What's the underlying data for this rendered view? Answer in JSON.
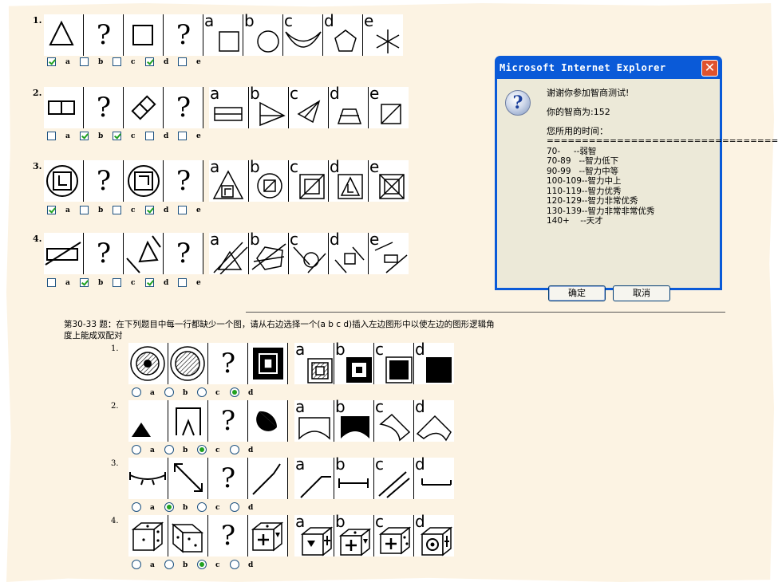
{
  "sectionA": {
    "problems": [
      {
        "num": "1.",
        "checked": [
          true,
          false,
          false,
          true,
          false
        ]
      },
      {
        "num": "2.",
        "checked": [
          false,
          true,
          true,
          false,
          false
        ]
      },
      {
        "num": "3.",
        "checked": [
          true,
          false,
          false,
          true,
          false
        ]
      },
      {
        "num": "4.",
        "checked": [
          false,
          true,
          false,
          true,
          false
        ]
      }
    ],
    "option_letters": [
      "a",
      "b",
      "c",
      "d",
      "e"
    ],
    "question_mark": "?"
  },
  "instruction": "第30-33 题：在下列题目中每一行都缺少一个图，请从右边选择一个(a b c d)插入左边图形中以使左边的图形逻辑角度上能成双配对",
  "sectionB": {
    "problems": [
      {
        "num": "1.",
        "selected": "d"
      },
      {
        "num": "2.",
        "selected": "c"
      },
      {
        "num": "3.",
        "selected": "b"
      },
      {
        "num": "4.",
        "selected": "c"
      }
    ],
    "option_letters": [
      "a",
      "b",
      "c",
      "d"
    ],
    "question_mark": "?"
  },
  "dialog": {
    "title": "Microsoft Internet Explorer",
    "close_glyph": "✕",
    "icon_glyph": "?",
    "lines": [
      "谢谢你参加智商测试!",
      "",
      "你的智商为:152",
      "",
      "您所用的时间：",
      "=====================================",
      "70-     --弱智",
      "70-89   --智力低下",
      "90-99   --智力中等",
      "100-109--智力中上",
      "110-119--智力优秀",
      "120-129--智力非常优秀",
      "130-139--智力非常非常优秀",
      "140+    --天才"
    ],
    "ok_label": "确定",
    "cancel_label": "取消"
  }
}
